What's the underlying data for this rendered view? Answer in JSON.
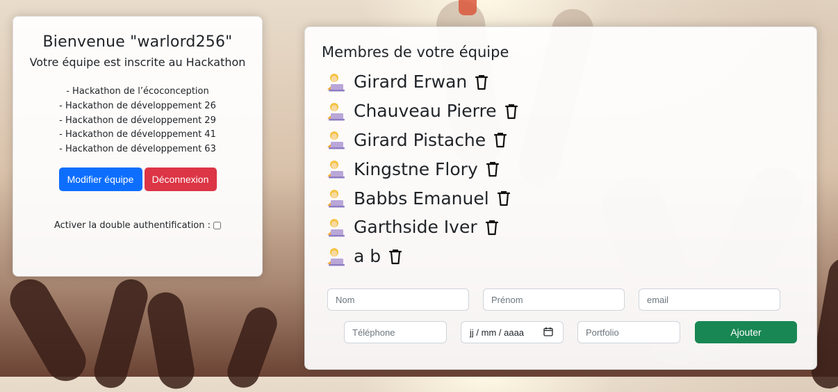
{
  "welcome_title": "Bienvenue \"warlord256\"",
  "registered_text": "Votre équipe est inscrite au Hackathon",
  "hackathons": [
    "- Hackathon de l’écoconception",
    "- Hackathon de développement 26",
    "- Hackathon de développement 29",
    "- Hackathon de développement 41",
    "- Hackathon de développement 63"
  ],
  "buttons": {
    "edit_team": "Modifier équipe",
    "logout": "Déconnexion",
    "add": "Ajouter"
  },
  "twofa_label": "Activer la double authentification :",
  "members_title": "Membres de votre équipe",
  "members": [
    "Girard Erwan",
    "Chauveau Pierre",
    "Girard Pistache",
    "Kingstne Flory",
    "Babbs Emanuel",
    "Garthside Iver",
    "a b"
  ],
  "form": {
    "nom_placeholder": "Nom",
    "prenom_placeholder": "Prénom",
    "email_placeholder": "email",
    "telephone_placeholder": "Téléphone",
    "date_value": "jj / mm / aaaa",
    "portfolio_placeholder": "Portfolio"
  },
  "colors": {
    "primary": "#0d6efd",
    "danger": "#dc3545",
    "success": "#198754"
  },
  "icons": {
    "member": "technologist-icon",
    "delete": "trash-icon",
    "calendar": "calendar-icon"
  }
}
